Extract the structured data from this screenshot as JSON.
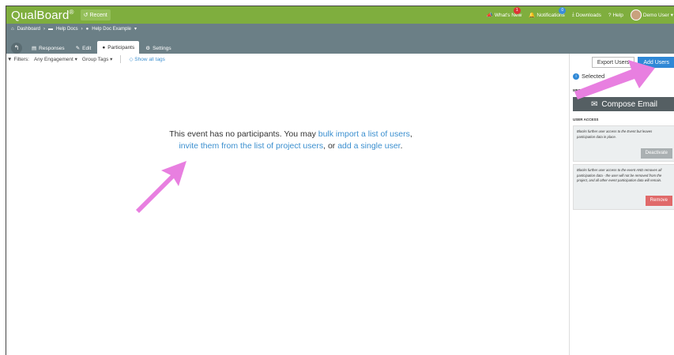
{
  "app": {
    "logo": "QualBoard",
    "logo_mark": "®",
    "recent_label": "Recent"
  },
  "topnav": {
    "whats_new": "What's New",
    "whats_new_badge": "1",
    "notifications": "Notifications",
    "notifications_badge": "0",
    "downloads": "Downloads",
    "help": "Help",
    "user": "Demo User"
  },
  "breadcrumb": {
    "items": [
      "Dashboard",
      "Help Docs",
      "Help Doc Example"
    ]
  },
  "tabs": [
    {
      "label": "Responses"
    },
    {
      "label": "Edit"
    },
    {
      "label": "Participants"
    },
    {
      "label": "Settings"
    }
  ],
  "filters": {
    "label": "Filters:",
    "engagement": "Any Engagement",
    "group_tags": "Group Tags",
    "show_all_tags": "Show all tags"
  },
  "message": {
    "part1": "This event has no participants. You may ",
    "link_bulk": "bulk import a list of users",
    "part2": ",",
    "link_invite": "invite them from the list of project users",
    "part3": ", or ",
    "link_single": "add a single user",
    "part4": "."
  },
  "panel": {
    "export_users": "Export Users",
    "add_users": "Add Users",
    "selected": "Selected",
    "messages_label": "MESSAGES",
    "compose_email": "Compose Email",
    "user_access_label": "USER ACCESS",
    "deactivate_text": "Blocks further user access to the Event but leaves participation data in place.",
    "deactivate": "Deactivate",
    "remove_text": "Blocks further user access to the event AND removes all participation data - the user will not be removed from the project, and all other event participation data will remain.",
    "remove": "Remove"
  },
  "colors": {
    "topbar": "#7fae3e",
    "subbar": "#6b7f86",
    "link": "#3b8fcf",
    "arrow": "#e87fe0"
  }
}
